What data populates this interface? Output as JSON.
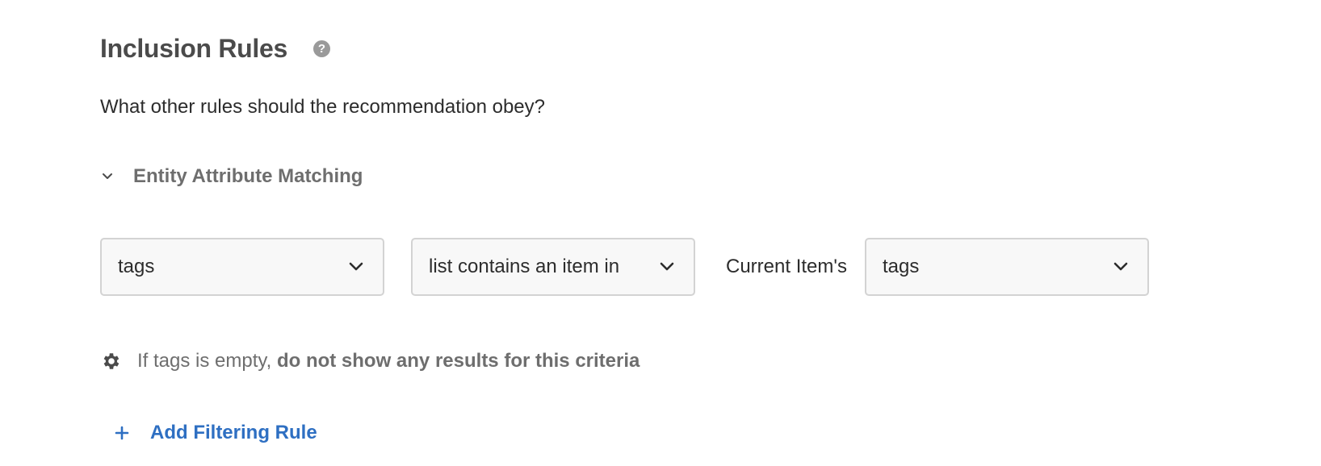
{
  "section": {
    "title": "Inclusion Rules",
    "help_icon": "help-circle-icon",
    "question": "What other rules should the recommendation obey?"
  },
  "entity_matching": {
    "label": "Entity Attribute Matching",
    "expanded": true,
    "toggle_icon": "chevron-down-icon"
  },
  "rule": {
    "attribute": "tags",
    "operator": "list contains an item in",
    "source_label": "Current Item's",
    "source_attribute": "tags"
  },
  "empty_behavior": {
    "icon": "gear-icon",
    "prefix": "If tags is empty,",
    "action": "do not show any results for this criteria"
  },
  "add_rule": {
    "label": "Add Filtering Rule",
    "icon": "plus-icon"
  },
  "colors": {
    "link_blue": "#2e6fc2",
    "heading_gray": "#4b4b4b",
    "muted_gray": "#6e6e6e",
    "field_border": "#d3d3d3",
    "field_bg": "#f8f8f8"
  }
}
